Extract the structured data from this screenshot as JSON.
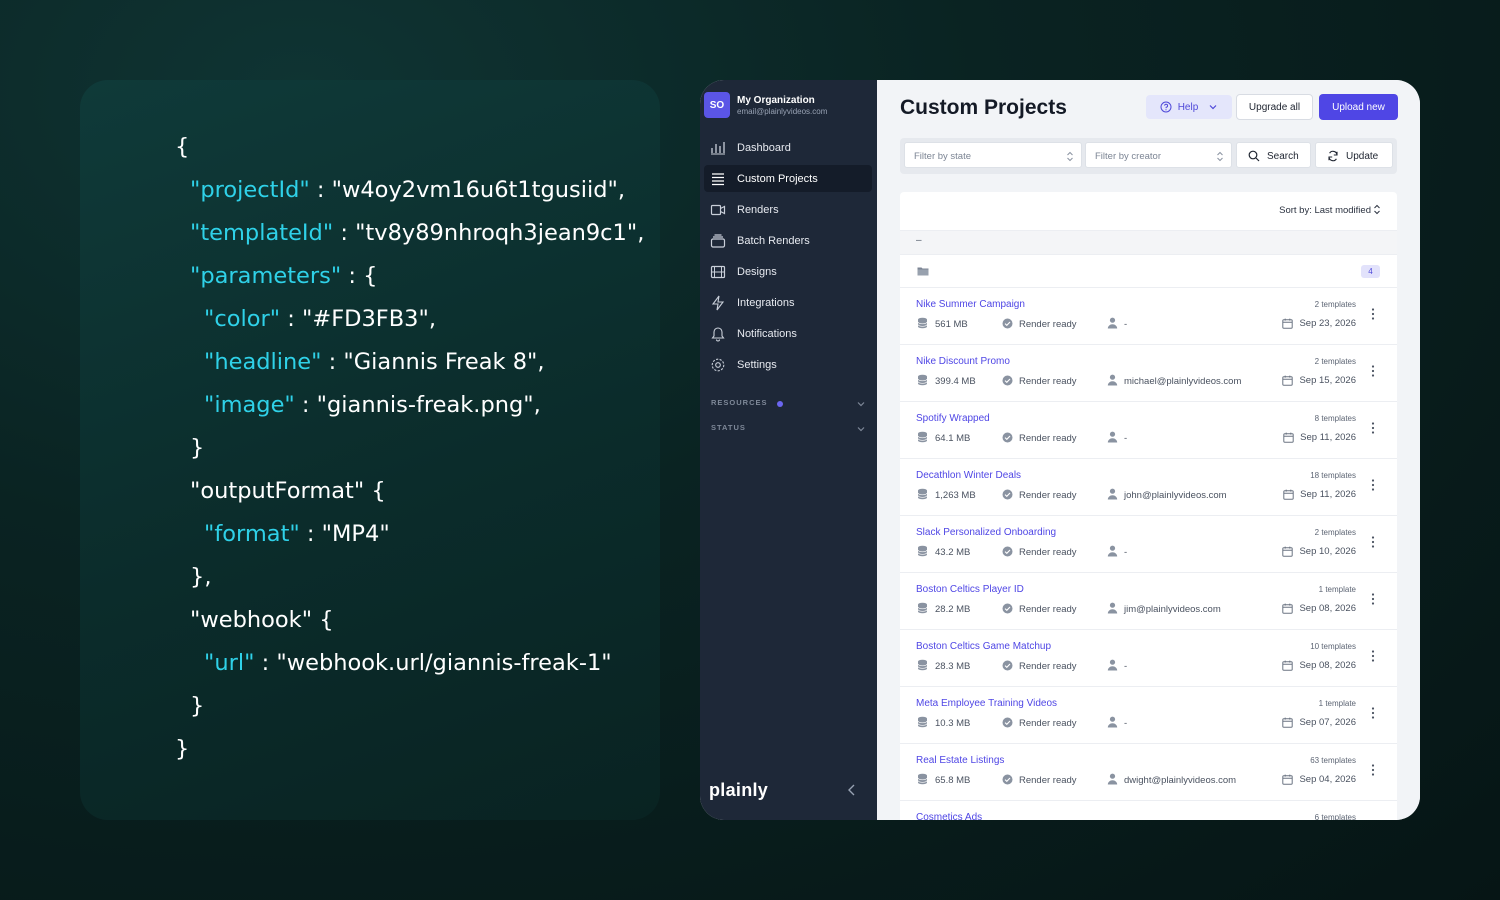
{
  "code": {
    "lines": [
      {
        "indent": 0,
        "text": "{"
      },
      {
        "indent": 1,
        "key": "\"projectId\"",
        "sep": " : ",
        "value": "\"w4oy2vm16u6t1tgusiid\","
      },
      {
        "indent": 1,
        "key": "\"templateId\"",
        "sep": " : ",
        "value": "\"tv8y89nhroqh3jean9c1\","
      },
      {
        "indent": 1,
        "key": "\"parameters\"",
        "sep": " : ",
        "value": "{"
      },
      {
        "indent": 2,
        "key": "\"color\"",
        "sep": " : ",
        "value": "\"#FD3FB3\","
      },
      {
        "indent": 2,
        "key": "\"headline\"",
        "sep": " : ",
        "value": "\"Giannis Freak 8\","
      },
      {
        "indent": 2,
        "key": "\"image\"",
        "sep": " : ",
        "value": "\"giannis-freak.png\","
      },
      {
        "indent": 1,
        "text": "}"
      },
      {
        "indent": 1,
        "text": "\"outputFormat\" {"
      },
      {
        "indent": 2,
        "key": "\"format\"",
        "sep": " : ",
        "value": "\"MP4\""
      },
      {
        "indent": 1,
        "text": "},"
      },
      {
        "indent": 1,
        "text": "\"webhook\" {"
      },
      {
        "indent": 2,
        "key": "\"url\"",
        "sep": " : ",
        "value": "\"webhook.url/giannis-freak-1\""
      },
      {
        "indent": 1,
        "text": "}"
      },
      {
        "indent": 0,
        "text": "}"
      }
    ]
  },
  "sidebar": {
    "org": {
      "initials": "SO",
      "name": "My Organization",
      "email": "email@plainlyvideos.com"
    },
    "items": [
      {
        "label": "Dashboard",
        "icon": "chart-icon"
      },
      {
        "label": "Custom Projects",
        "icon": "list-icon",
        "active": true
      },
      {
        "label": "Renders",
        "icon": "video-icon"
      },
      {
        "label": "Batch Renders",
        "icon": "stack-icon"
      },
      {
        "label": "Designs",
        "icon": "film-icon"
      },
      {
        "label": "Integrations",
        "icon": "bolt-icon"
      },
      {
        "label": "Notifications",
        "icon": "bell-icon"
      },
      {
        "label": "Settings",
        "icon": "gear-icon"
      }
    ],
    "sections": [
      "RESOURCES",
      "STATUS"
    ],
    "logo": "plainly"
  },
  "header": {
    "title": "Custom Projects",
    "help_label": "Help",
    "upgrade_label": "Upgrade all",
    "upload_label": "Upload new"
  },
  "filters": {
    "state_placeholder": "Filter by state",
    "creator_placeholder": "Filter by creator",
    "search_label": "Search",
    "update_label": "Update"
  },
  "list": {
    "sort_label": "Sort by: Last modified",
    "group_label": "–",
    "group_count": "4",
    "projects": [
      {
        "name": "Nike Summer Campaign",
        "templates": "2 templates",
        "size": "561 MB",
        "state": "Render ready",
        "creator": "-",
        "date": "Sep 23, 2026"
      },
      {
        "name": "Nike Discount Promo",
        "templates": "2 templates",
        "size": "399.4 MB",
        "state": "Render ready",
        "creator": "michael@plainlyvideos.com",
        "date": "Sep 15, 2026"
      },
      {
        "name": "Spotify Wrapped",
        "templates": "8 templates",
        "size": "64.1 MB",
        "state": "Render ready",
        "creator": "-",
        "date": "Sep 11, 2026"
      },
      {
        "name": "Decathlon Winter Deals",
        "templates": "18 templates",
        "size": "1,263 MB",
        "state": "Render ready",
        "creator": "john@plainlyvideos.com",
        "date": "Sep 11, 2026"
      },
      {
        "name": "Slack Personalized Onboarding",
        "templates": "2 templates",
        "size": "43.2 MB",
        "state": "Render ready",
        "creator": "-",
        "date": "Sep 10, 2026"
      },
      {
        "name": "Boston Celtics Player ID",
        "templates": "1 template",
        "size": "28.2 MB",
        "state": "Render ready",
        "creator": "jim@plainlyvideos.com",
        "date": "Sep 08, 2026"
      },
      {
        "name": "Boston Celtics Game Matchup",
        "templates": "10 templates",
        "size": "28.3 MB",
        "state": "Render ready",
        "creator": "-",
        "date": "Sep 08, 2026"
      },
      {
        "name": "Meta Employee Training Videos",
        "templates": "1 template",
        "size": "10.3 MB",
        "state": "Render ready",
        "creator": "-",
        "date": "Sep 07, 2026"
      },
      {
        "name": "Real Estate Listings",
        "templates": "63 templates",
        "size": "65.8 MB",
        "state": "Render ready",
        "creator": "dwight@plainlyvideos.com",
        "date": "Sep 04, 2026"
      },
      {
        "name": "Cosmetics Ads",
        "templates": "6 templates",
        "size": "",
        "state": "",
        "creator": "",
        "date": ""
      }
    ]
  },
  "colors": {
    "accent": "#4f46e5",
    "code_key": "#2fd1e8",
    "sidebar_bg": "#1e2838"
  }
}
